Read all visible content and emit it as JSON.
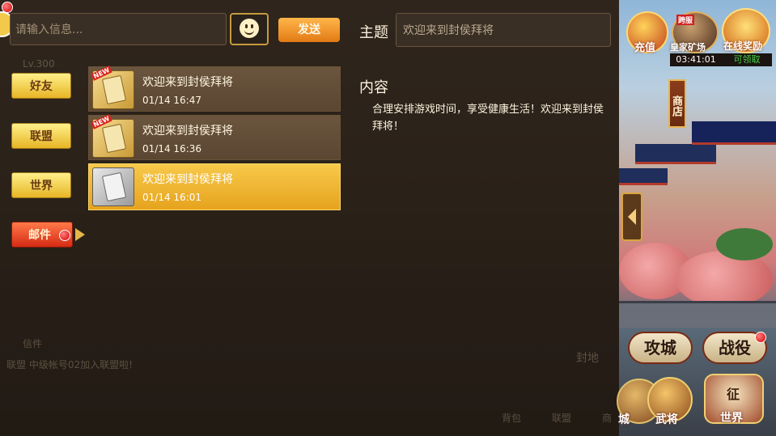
{
  "chat_bar": {
    "input_placeholder": "请输入信息...",
    "send_label": "发送"
  },
  "nav": {
    "friends": "好友",
    "alliance": "联盟",
    "world": "世界",
    "mail": "邮件"
  },
  "mails": [
    {
      "subject": "欢迎来到封侯拜将",
      "date": "01/14 16:47",
      "new": true,
      "selected": false
    },
    {
      "subject": "欢迎来到封侯拜将",
      "date": "01/14 16:36",
      "new": true,
      "selected": false
    },
    {
      "subject": "欢迎来到封侯拜将",
      "date": "01/14 16:01",
      "new": false,
      "selected": true
    }
  ],
  "detail": {
    "subject_label": "主题",
    "subject_value": "欢迎来到封侯拜将",
    "content_label": "内容",
    "content_text": "合理安排游戏时间，享受健康生活！欢迎来到封侯拜将！"
  },
  "background": {
    "level": "Lv.300",
    "letter": "信件",
    "chat_line": "联盟 中级帐号02加入联盟啦!",
    "fief": "封地",
    "bag": "背包",
    "alliance": "联盟",
    "shop_partial": "商"
  },
  "hud": {
    "recharge": "充值",
    "royal_mine": "皇家矿场",
    "online_reward": "在线奖励",
    "cross_server": "跨服",
    "timer": "03:41:01",
    "claimable": "可领取",
    "shop": "商店",
    "siege": "攻城",
    "battle": "战役",
    "city_partial": "城",
    "generals": "武将",
    "world": "世界",
    "world_badge": "征"
  },
  "colors": {
    "accent_gold": "#e7b526",
    "mail_red": "#d62a14",
    "claim_green": "#49d34a"
  }
}
